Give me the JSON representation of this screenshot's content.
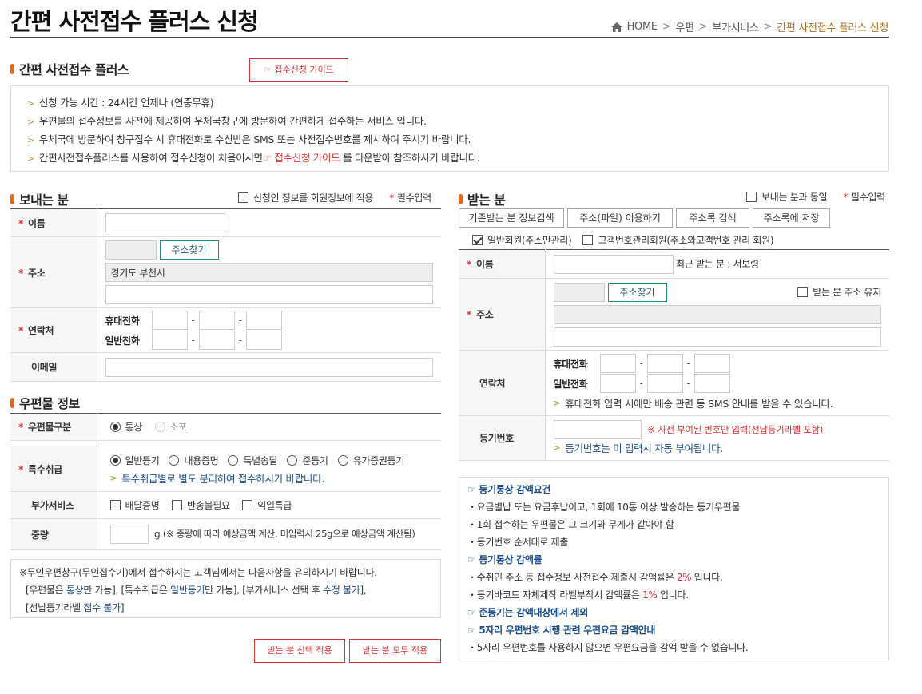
{
  "page": {
    "title": "간편 사전접수 플러스 신청"
  },
  "breadcrumb": {
    "home": "HOME",
    "items": [
      "우편",
      "부가서비스"
    ],
    "current": "간편 사전접수 플러스 신청",
    "sep": ">"
  },
  "intro": {
    "heading": "간편 사전접수 플러스",
    "guide_button": "☞ 접수신청 가이드",
    "lines": [
      "신청 가능 시간 : 24시간 언제나 (연중무휴)",
      "우편물의 접수정보를 사전에 제공하여 우체국창구에 방문하여 간편하게 접수하는 서비스 입니다.",
      "우체국에 방문하여 창구접수 시 휴대전화로 수신받은 SMS 또는 사전접수번호를 제시하여 주시기 바랍니다."
    ],
    "line4_pre": "간편사전접수플러스를 사용하여 접수신청이 처음이시면",
    "line4_link": "☞ 접수신청 가이드",
    "line4_post": " 를 다운받아 참조하시기 바랍니다."
  },
  "sender": {
    "heading": "보내는 분",
    "apply_member": "신청인 정보를 회원정보에 적용",
    "required": "필수입력",
    "asterisk": "*",
    "name_label": "이름",
    "address_label": "주소",
    "address_btn": "주소찾기",
    "address_value": "경기도 부천시",
    "contact_label": "연락처",
    "mobile_label": "휴대전화",
    "phone_label": "일반전화",
    "email_label": "이메일",
    "dash": "-"
  },
  "mail": {
    "heading": "우편물 정보",
    "type_label": "우편물구분",
    "type_opts": [
      "통상",
      "소포"
    ],
    "special_label": "특수취급",
    "special_opts": [
      "일반등기",
      "내용증명",
      "특별송달",
      "준등기",
      "유가증권등기"
    ],
    "special_note": "특수취급별로 별도 분리하여 접수하시기 바랍니다.",
    "extra_label": "부가서비스",
    "extra_opts": [
      "배달증명",
      "반송불필요",
      "익일특급"
    ],
    "weight_label": "중량",
    "weight_unit": "g",
    "weight_note": "(※ 중량에 따라 예상금액 계산, 미입력시 25g으로 예상금액 계산됨)"
  },
  "notice": {
    "line1": "※무인우편창구(무인접수기)에서 접수하시는 고객님께서는 다음사항을 유의하시기 바랍니다.",
    "l2a": "[우편물은 ",
    "l2b": "통상",
    "l2c": "만 가능], [특수취급은 ",
    "l2d": "일반등기",
    "l2e": "만 가능], [부가서비스 선택 후 ",
    "l2f": "수정 불가",
    "l2g": "],",
    "l3a": "[선납등기라벨 ",
    "l3b": "접수 불가",
    "l3c": "]"
  },
  "buttons": {
    "apply_selected": "받는 분 선택 적용",
    "apply_all": "받는 분 모두 적용"
  },
  "receiver": {
    "heading": "받는 분",
    "same_as_sender": "보내는 분과 동일",
    "required": "필수입력",
    "btns": [
      "기존받는 분 정보검색",
      "주소(파일) 이용하기",
      "주소록 검색",
      "주소록에 저장"
    ],
    "member_opts": [
      "일반회원(주소만관리)",
      "고객번호관리회원(주소와고객번호 관리 회원)"
    ],
    "name_label": "이름",
    "recent": "최근 받는 분 : 서보령",
    "address_label": "주소",
    "address_btn": "주소찾기",
    "keep_address": "받는 분 주소 유지",
    "contact_label": "연락처",
    "mobile_label": "휴대전화",
    "phone_label": "일반전화",
    "sms_note": "휴대전화 입력 시에만 배송 관련 등 SMS 안내를 받을 수 있습니다.",
    "reg_label": "등기번호",
    "reg_warn": "※ 사전 부여된 번호만 입력(선납등기라벨 포함)",
    "reg_note": "등기번호는 미 입력시 자동 부여됩니다."
  },
  "discount": {
    "h1": "☞ 등기통상 감액요건",
    "l1": "・요금별납 또는 요금후납이고, 1회에 10통 이상 발송하는 등기우편물",
    "l2": "・1회 접수하는 우편물은 그 크기와 무게가 같아야 함",
    "l3": "・등기번호 순서대로 제출",
    "h2": "☞ 등기통상 감액률",
    "l4a": "・수취인 주소 등 접수정보 사전접수 제출시 감액률은 ",
    "l4b": "2%",
    "l4c": " 입니다.",
    "l5a": "・등기바코드 자체제작 라벨부착시 감액률은 ",
    "l5b": "1%",
    "l5c": " 입니다.",
    "h3": "☞ 준등기는 감액대상에서 제외",
    "h4": "☞ 5자리 우편번호 시행 관련 우편요금 감액안내",
    "l6": "・5자리 우편번호를 사용하지 않으면 우편요금을 감액 받을 수 없습니다."
  },
  "colors": {
    "accent": "#e8641b",
    "red": "#dd3333",
    "blue": "#1f4f8f",
    "breadcrumb_current": "#b0702a"
  }
}
